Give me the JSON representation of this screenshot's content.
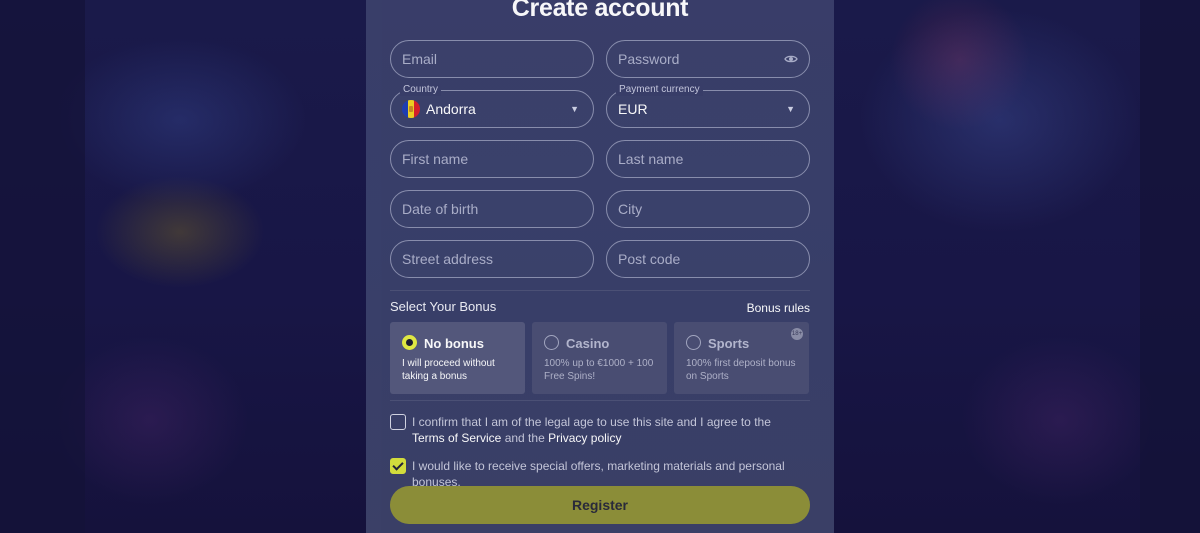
{
  "modal": {
    "title": "Create account"
  },
  "form": {
    "email": {
      "placeholder": "Email"
    },
    "password": {
      "placeholder": "Password",
      "icon": "eye-icon"
    },
    "country": {
      "label": "Country",
      "value": "Andorra",
      "flag_icon": "andorra-flag-icon"
    },
    "currency": {
      "label": "Payment currency",
      "value": "EUR"
    },
    "first_name": {
      "placeholder": "First name"
    },
    "last_name": {
      "placeholder": "Last name"
    },
    "date_of_birth": {
      "placeholder": "Date of birth"
    },
    "city": {
      "placeholder": "City"
    },
    "street_address": {
      "placeholder": "Street address"
    },
    "post_code": {
      "placeholder": "Post code"
    }
  },
  "bonus": {
    "heading": "Select Your Bonus",
    "rules_link": "Bonus rules",
    "selected": "No bonus",
    "options": [
      {
        "name": "No bonus",
        "desc": "I will proceed without taking a bonus"
      },
      {
        "name": "Casino",
        "desc": "100% up to €1000 + 100 Free Spins!"
      },
      {
        "name": "Sports",
        "desc": "100% first deposit bonus on Sports",
        "badge": "18+"
      }
    ]
  },
  "consents": {
    "terms": {
      "checked": false,
      "text_before": "I confirm that I am of the legal age to use this site and I agree to the",
      "terms_link": "Terms of Service",
      "and": "and the",
      "privacy_link": "Privacy policy"
    },
    "marketing": {
      "checked": true,
      "text": "I would like to receive special offers, marketing materials and personal bonuses."
    }
  },
  "register_button": "Register",
  "colors": {
    "accent": "#e6ee43",
    "button": "#8f9138",
    "modal_bg": "#3a3f6a"
  }
}
